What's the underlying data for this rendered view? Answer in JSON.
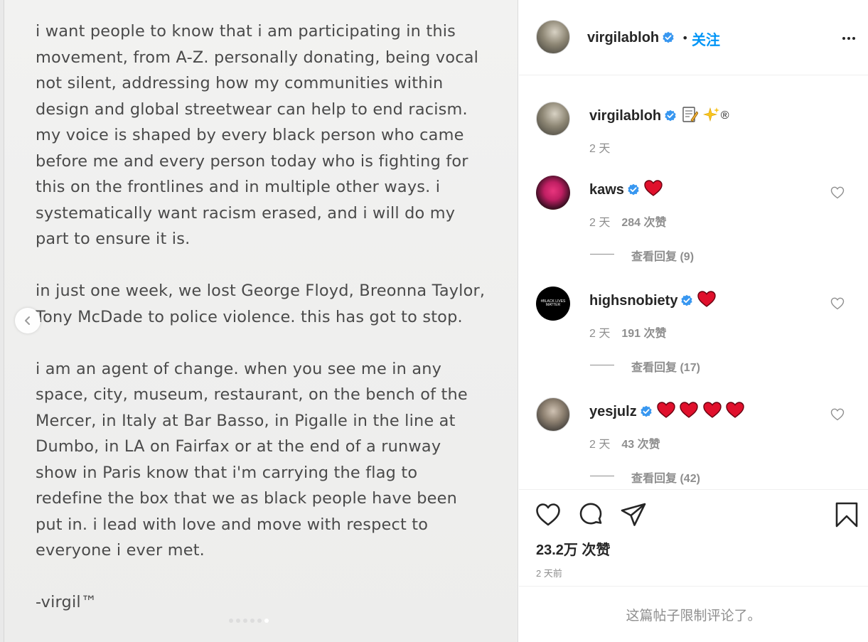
{
  "post": {
    "paragraphs": [
      "i want people to know that i am participating in this\nmovement, from A-Z. personally donating, being vocal\nnot silent, addressing how my communities within\ndesign and global streetwear can help to end racism.\nmy voice is shaped by every black person who came\nbefore me and every person today who is fighting for\nthis on the frontlines and in multiple other ways. i\nsystematically want racism erased, and i will do my\npart to ensure it is.",
      "in just one week, we lost George Floyd, Breonna Taylor,\nTony McDade to police violence. this has got to stop.",
      "i am an agent of change. when you see me in any\nspace, city, museum, restaurant, on the bench of the\nMercer, in Italy at Bar Basso, in Pigalle in the line at\nDumbo, in LA on Fairfax or at the end of a runway\nshow in Paris know that i'm carrying the flag to\nredefine the box that we as black people have been\nput in. i lead with love and move with respect to\neveryone i ever met.",
      "-virgil™"
    ],
    "carousel": {
      "total": 6,
      "active_index": 5
    }
  },
  "header": {
    "username": "virgilabloh",
    "separator": "•",
    "follow_label": "关注"
  },
  "caption": {
    "username": "virgilabloh",
    "text_emojis": "📝✨",
    "registered": "®",
    "time": "2 天"
  },
  "comments": [
    {
      "username": "kaws",
      "hearts": 1,
      "time": "2 天",
      "likes": "284 次赞",
      "replies_label": "查看回复",
      "replies_count": "(9)"
    },
    {
      "username": "highsnobiety",
      "avatar_text": "#BLACK LIVES MATTER",
      "hearts": 1,
      "time": "2 天",
      "likes": "191 次赞",
      "replies_label": "查看回复",
      "replies_count": "(17)"
    },
    {
      "username": "yesjulz",
      "hearts": 4,
      "time": "2 天",
      "likes": "43 次赞",
      "replies_label": "查看回复",
      "replies_count": "(42)"
    }
  ],
  "actions": {
    "likes_count": "23.2万 次赞",
    "post_time": "2 天前",
    "comments_limited": "这篇帖子限制评论了。"
  },
  "colors": {
    "link_blue": "#0095f6",
    "verified_blue": "#3897f0",
    "heart_red": "#e0102c",
    "muted": "#8e8e8e",
    "text": "#262626"
  }
}
